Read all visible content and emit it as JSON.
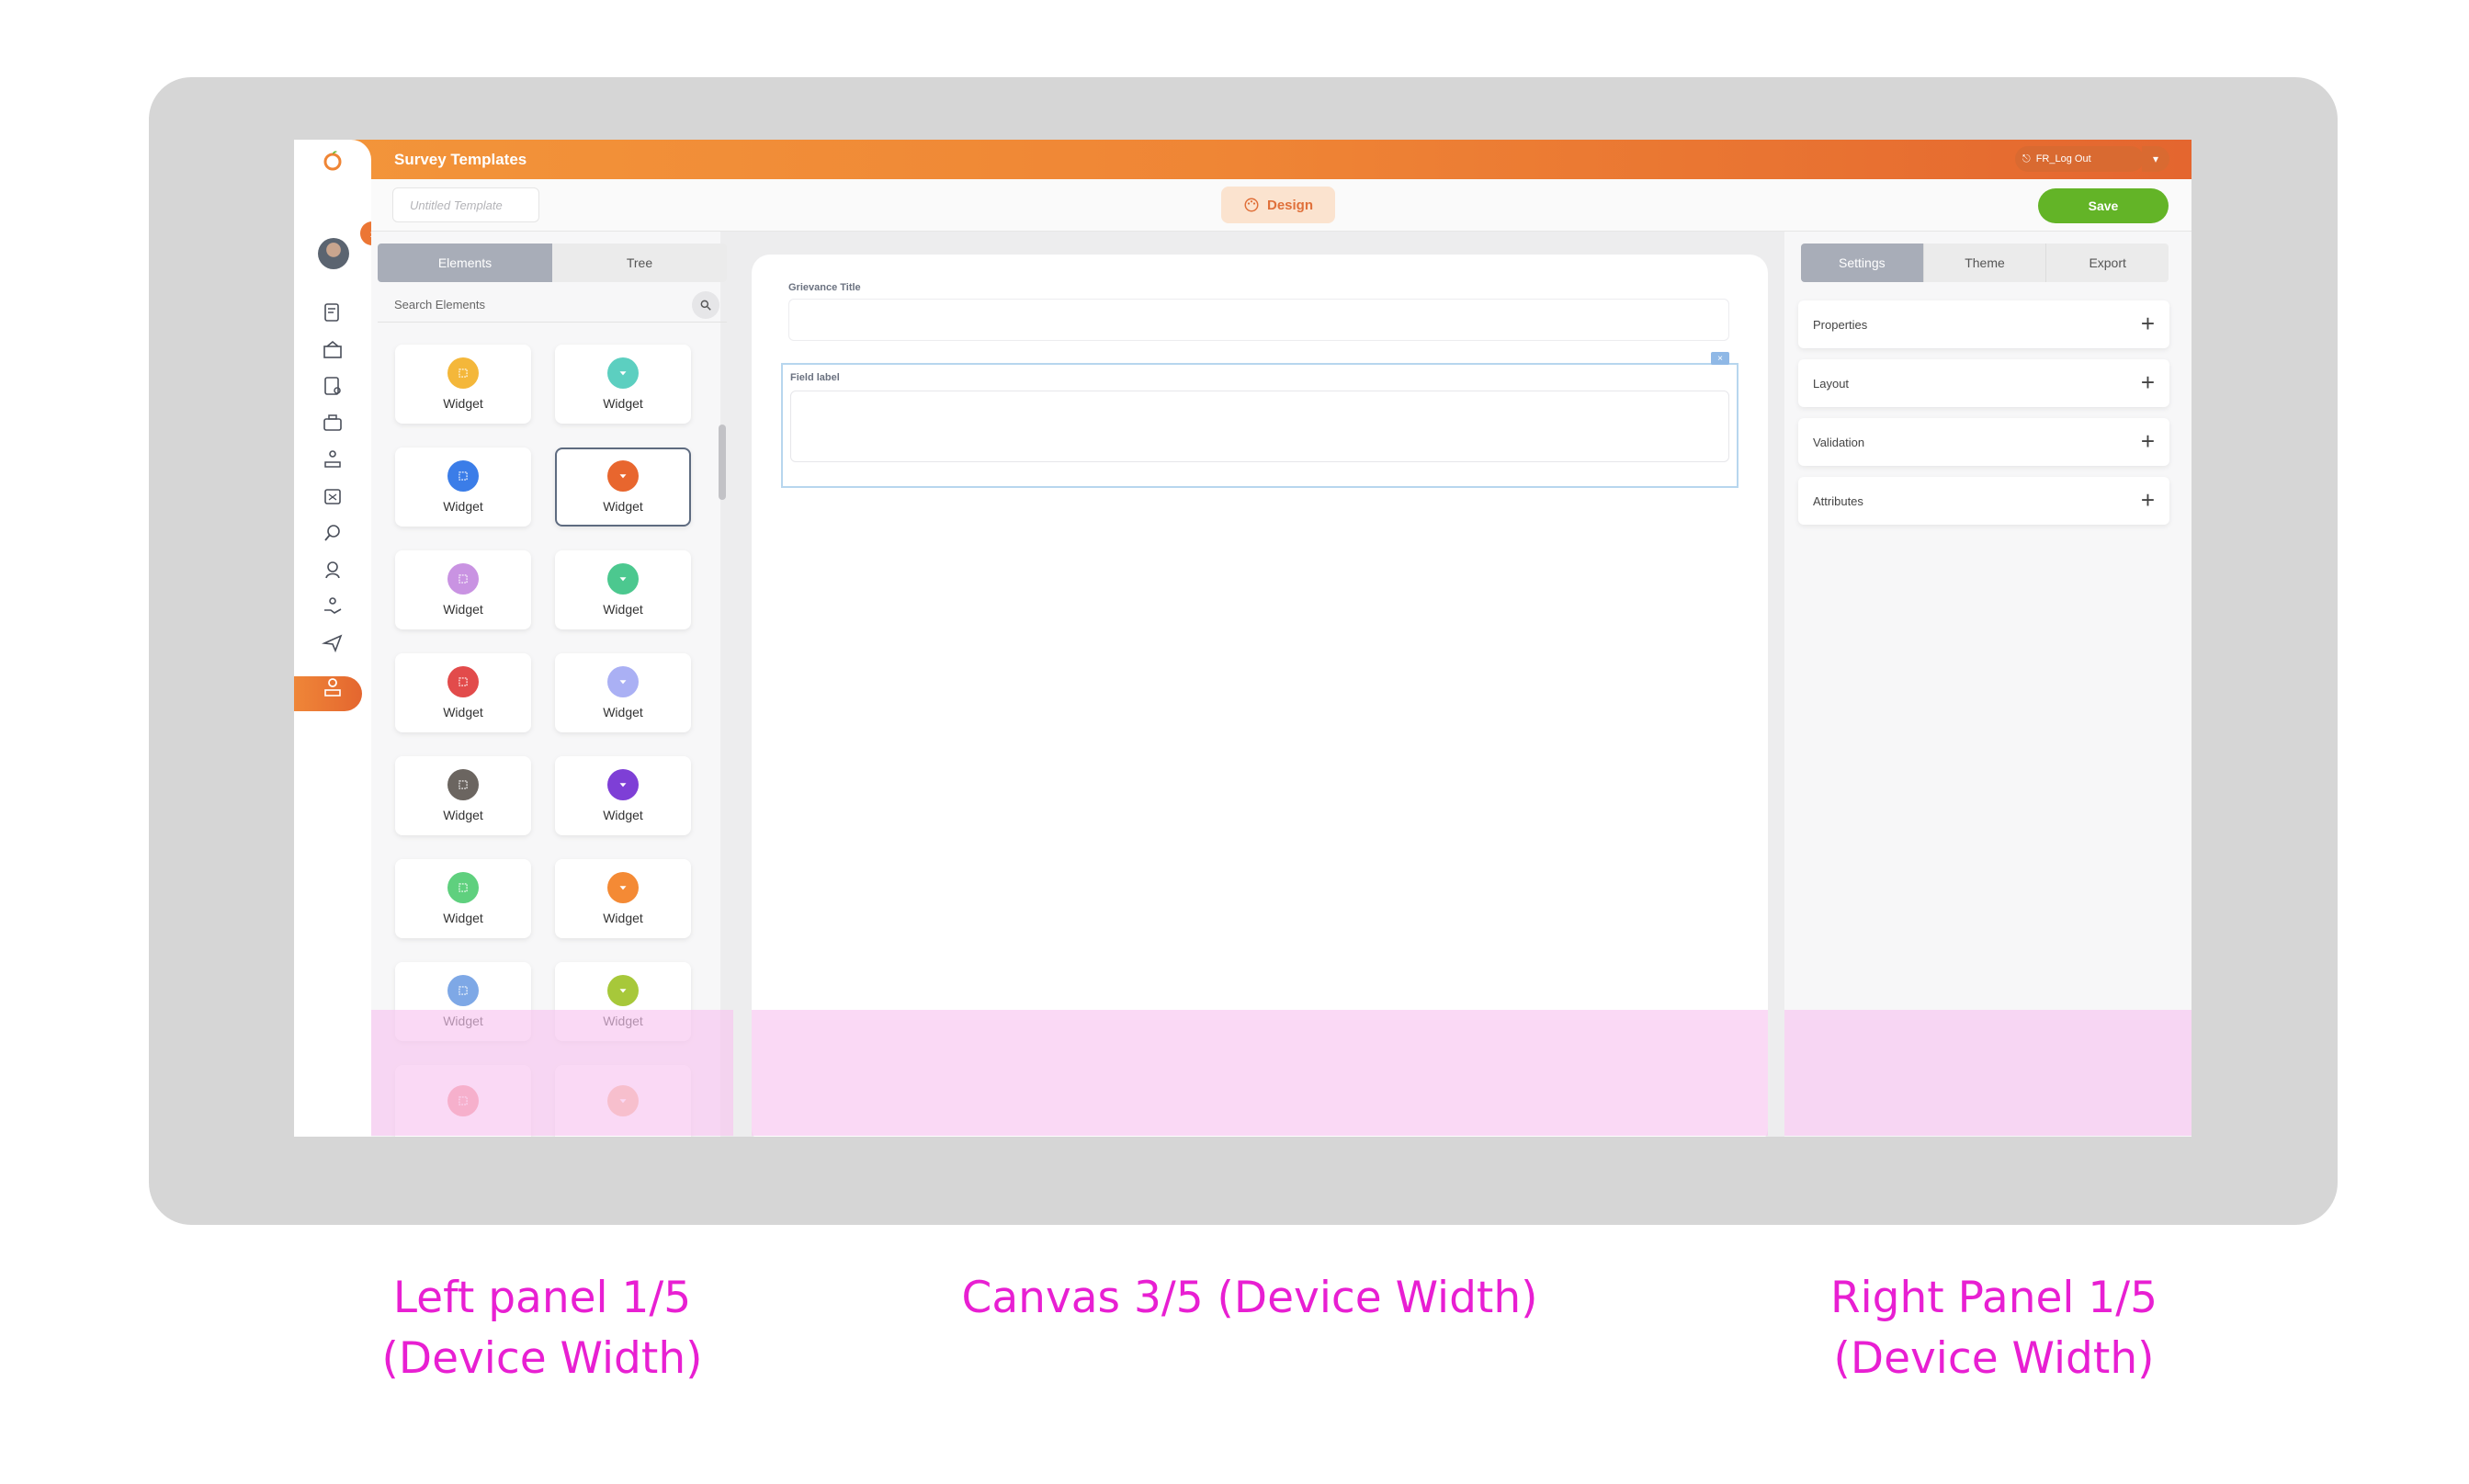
{
  "app": {
    "title": "Survey Templates",
    "logout_label": "FR_Log Out",
    "template_placeholder": "Untitled Template",
    "design_label": "Design",
    "save_label": "Save"
  },
  "left_panel": {
    "tabs": [
      "Elements",
      "Tree"
    ],
    "active_tab": "Elements",
    "search_placeholder": "Search Elements",
    "widgets": [
      {
        "label": "Widget",
        "color": "#f4b73a",
        "icon": "grid-icon"
      },
      {
        "label": "Widget",
        "color": "#5ccfc0",
        "icon": "dropdown-icon"
      },
      {
        "label": "Widget",
        "color": "#3b7de8",
        "icon": "grid-icon"
      },
      {
        "label": "Widget",
        "color": "#e8662e",
        "icon": "dropdown-icon",
        "selected": true
      },
      {
        "label": "Widget",
        "color": "#c993e2",
        "icon": "grid-icon"
      },
      {
        "label": "Widget",
        "color": "#4cc88f",
        "icon": "dropdown-icon"
      },
      {
        "label": "Widget",
        "color": "#e24b4b",
        "icon": "grid-icon"
      },
      {
        "label": "Widget",
        "color": "#aab0f4",
        "icon": "dropdown-icon"
      },
      {
        "label": "Widget",
        "color": "#6b6560",
        "icon": "grid-icon"
      },
      {
        "label": "Widget",
        "color": "#7e3fd6",
        "icon": "dropdown-icon"
      },
      {
        "label": "Widget",
        "color": "#5fd07e",
        "icon": "grid-icon"
      },
      {
        "label": "Widget",
        "color": "#f48a35",
        "icon": "dropdown-icon"
      },
      {
        "label": "Widget",
        "color": "#7ea8e6",
        "icon": "grid-icon"
      },
      {
        "label": "Widget",
        "color": "#a7c83a",
        "icon": "dropdown-icon"
      },
      {
        "label": "",
        "color": "#f48b8b",
        "icon": "grid-icon"
      },
      {
        "label": "",
        "color": "#f7b48e",
        "icon": "dropdown-icon"
      }
    ]
  },
  "canvas": {
    "field1_label": "Grievance Title",
    "field2_label": "Field label",
    "close_glyph": "×"
  },
  "right_panel": {
    "tabs": [
      "Settings",
      "Theme",
      "Export"
    ],
    "active_tab": "Settings",
    "sections": [
      "Properties",
      "Layout",
      "Validation",
      "Attributes"
    ]
  },
  "captions": {
    "left_line1": "Left panel 1/5",
    "left_line2": "(Device Width)",
    "center": "Canvas 3/5 (Device Width)",
    "right_line1": "Right Panel 1/5",
    "right_line2": "(Device Width)"
  },
  "colors": {
    "accent": "#ec7634",
    "save": "#63b427",
    "annotation": "#e81fd2"
  }
}
